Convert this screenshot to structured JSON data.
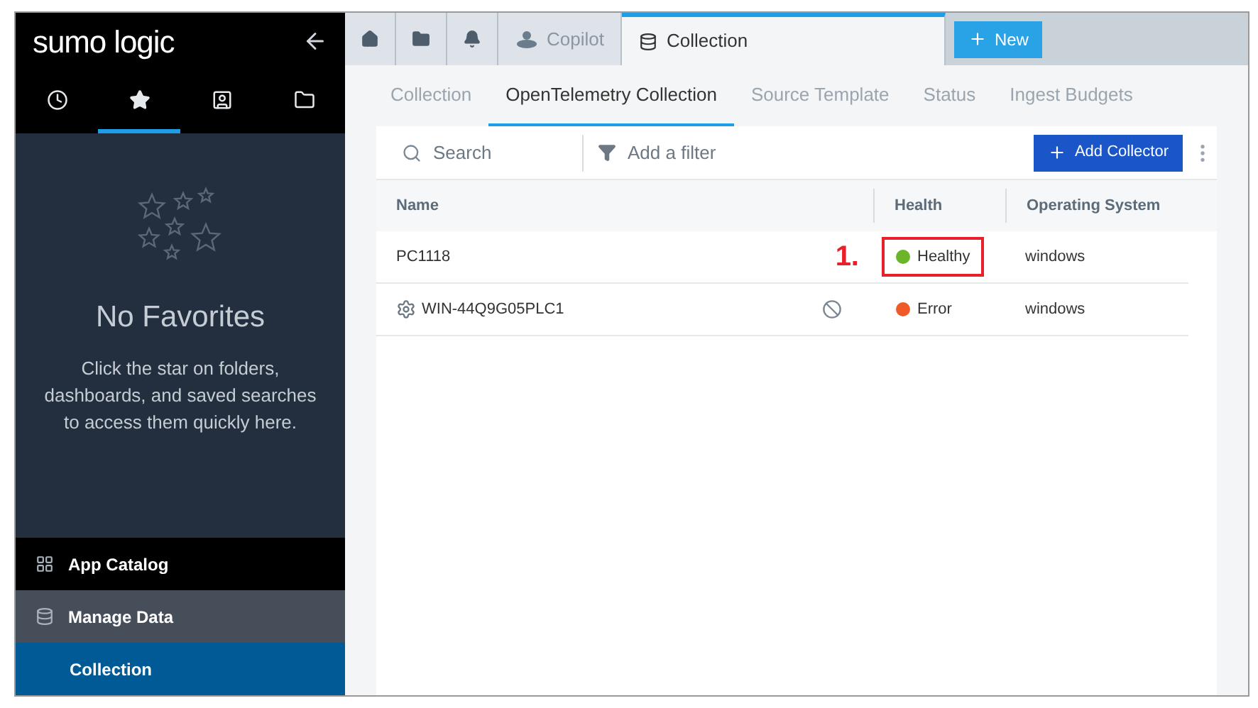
{
  "sidebar": {
    "logo": "sumo logic",
    "icon_tabs": [
      {
        "kind": "recent",
        "selected": false
      },
      {
        "kind": "favorites",
        "selected": true
      },
      {
        "kind": "personal",
        "selected": false
      },
      {
        "kind": "library",
        "selected": false
      }
    ],
    "empty_title": "No Favorites",
    "empty_text": "Click the star on folders, dashboards, and saved searches to access them quickly here.",
    "nav": [
      {
        "label": "App Catalog",
        "kind": "grid",
        "selected": false
      },
      {
        "label": "Manage Data",
        "kind": "database",
        "selected": false,
        "children": [
          {
            "label": "Collection",
            "selected": true
          }
        ]
      }
    ]
  },
  "top_tabs": [
    {
      "kind": "home",
      "selected": false
    },
    {
      "kind": "folder",
      "selected": false
    },
    {
      "kind": "bell",
      "selected": false
    },
    {
      "kind": "copilot",
      "label": "Copilot",
      "selected": false
    },
    {
      "kind": "database",
      "label": "Collection",
      "selected": true
    }
  ],
  "new_button": "New",
  "sub_tabs": [
    {
      "label": "Collection",
      "selected": false
    },
    {
      "label": "OpenTelemetry Collection",
      "selected": true
    },
    {
      "label": "Source Template",
      "selected": false
    },
    {
      "label": "Status",
      "selected": false
    },
    {
      "label": "Ingest Budgets",
      "selected": false
    }
  ],
  "toolbar": {
    "search_placeholder": "Search",
    "filter": "Add a filter",
    "add_button": "Add Collector"
  },
  "table": {
    "columns": [
      "Name",
      "Health",
      "Operating System"
    ],
    "rows": [
      {
        "name": "PC1118",
        "gear": false,
        "blocked": false,
        "health": "Healthy",
        "color": "#6bb52a",
        "os": "windows",
        "annotation": "1."
      },
      {
        "name": "WIN-44Q9G05PLC1",
        "gear": true,
        "blocked": true,
        "health": "Error",
        "color": "#f05a28",
        "os": "windows"
      }
    ]
  }
}
